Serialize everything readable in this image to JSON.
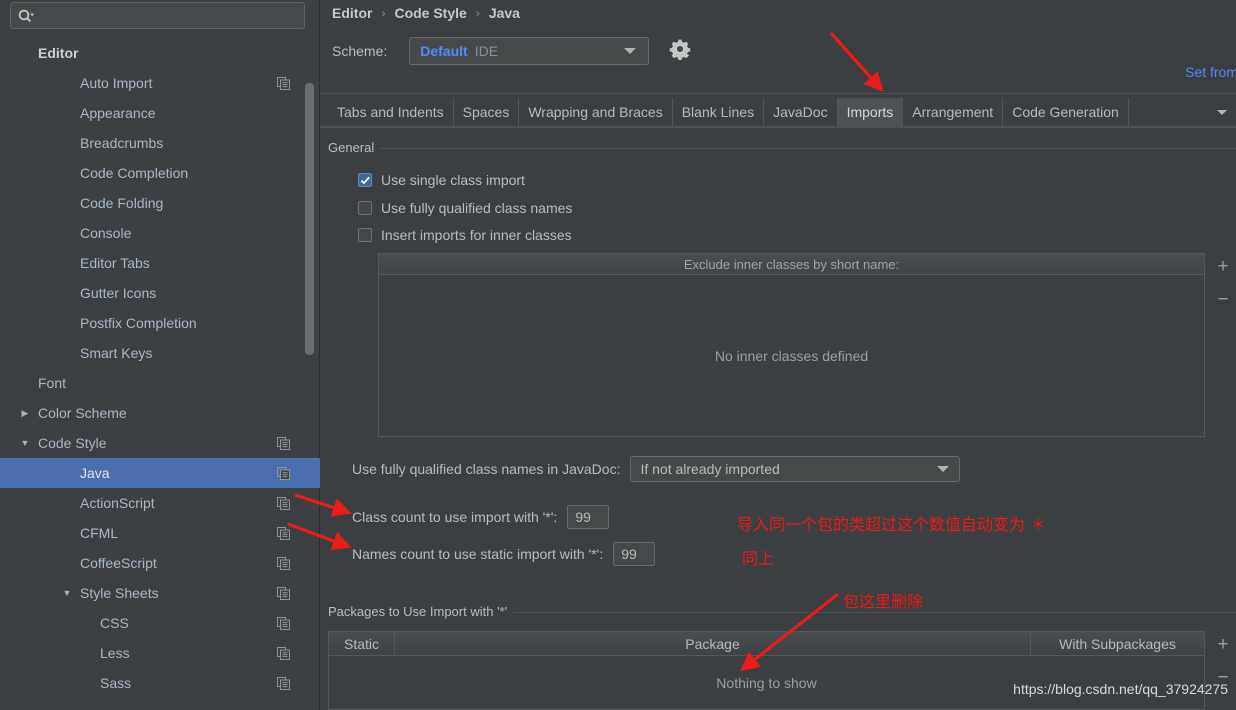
{
  "sidebar": {
    "search": {
      "value": "",
      "placeholder": "",
      "icon": "search-icon"
    },
    "items": [
      {
        "label": "Editor",
        "level": 0,
        "bold": true,
        "arrow": "",
        "copy": false,
        "selected": false
      },
      {
        "label": "Auto Import",
        "level": 1,
        "bold": false,
        "arrow": "",
        "copy": true,
        "selected": false
      },
      {
        "label": "Appearance",
        "level": 1,
        "bold": false,
        "arrow": "",
        "copy": false,
        "selected": false
      },
      {
        "label": "Breadcrumbs",
        "level": 1,
        "bold": false,
        "arrow": "",
        "copy": false,
        "selected": false
      },
      {
        "label": "Code Completion",
        "level": 1,
        "bold": false,
        "arrow": "",
        "copy": false,
        "selected": false
      },
      {
        "label": "Code Folding",
        "level": 1,
        "bold": false,
        "arrow": "",
        "copy": false,
        "selected": false
      },
      {
        "label": "Console",
        "level": 1,
        "bold": false,
        "arrow": "",
        "copy": false,
        "selected": false
      },
      {
        "label": "Editor Tabs",
        "level": 1,
        "bold": false,
        "arrow": "",
        "copy": false,
        "selected": false
      },
      {
        "label": "Gutter Icons",
        "level": 1,
        "bold": false,
        "arrow": "",
        "copy": false,
        "selected": false
      },
      {
        "label": "Postfix Completion",
        "level": 1,
        "bold": false,
        "arrow": "",
        "copy": false,
        "selected": false
      },
      {
        "label": "Smart Keys",
        "level": 1,
        "bold": false,
        "arrow": "",
        "copy": false,
        "selected": false
      },
      {
        "label": "Font",
        "level": 0,
        "bold": false,
        "arrow": "",
        "copy": false,
        "selected": false
      },
      {
        "label": "Color Scheme",
        "level": 0,
        "bold": false,
        "arrow": "▶",
        "copy": false,
        "selected": false
      },
      {
        "label": "Code Style",
        "level": 0,
        "bold": false,
        "arrow": "▼",
        "copy": true,
        "selected": false
      },
      {
        "label": "Java",
        "level": 1,
        "bold": false,
        "arrow": "",
        "copy": true,
        "selected": true
      },
      {
        "label": "ActionScript",
        "level": 1,
        "bold": false,
        "arrow": "",
        "copy": true,
        "selected": false
      },
      {
        "label": "CFML",
        "level": 1,
        "bold": false,
        "arrow": "",
        "copy": true,
        "selected": false
      },
      {
        "label": "CoffeeScript",
        "level": 1,
        "bold": false,
        "arrow": "",
        "copy": true,
        "selected": false
      },
      {
        "label": "Style Sheets",
        "level": 1,
        "bold": false,
        "arrow": "▼",
        "copy": true,
        "selected": false
      },
      {
        "label": "CSS",
        "level": 2,
        "bold": false,
        "arrow": "",
        "copy": true,
        "selected": false
      },
      {
        "label": "Less",
        "level": 2,
        "bold": false,
        "arrow": "",
        "copy": true,
        "selected": false
      },
      {
        "label": "Sass",
        "level": 2,
        "bold": false,
        "arrow": "",
        "copy": true,
        "selected": false
      }
    ]
  },
  "breadcrumb": {
    "items": [
      "Editor",
      "Code Style",
      "Java"
    ],
    "separator": "›"
  },
  "scheme": {
    "label": "Scheme:",
    "name": "Default",
    "qualifier": "IDE",
    "gear_icon": "gear-icon",
    "set_from_label": "Set from"
  },
  "tabs": {
    "items": [
      {
        "label": "Tabs and Indents",
        "active": false
      },
      {
        "label": "Spaces",
        "active": false
      },
      {
        "label": "Wrapping and Braces",
        "active": false
      },
      {
        "label": "Blank Lines",
        "active": false
      },
      {
        "label": "JavaDoc",
        "active": false
      },
      {
        "label": "Imports",
        "active": true
      },
      {
        "label": "Arrangement",
        "active": false
      },
      {
        "label": "Code Generation",
        "active": false
      }
    ]
  },
  "general": {
    "title": "General",
    "checkboxes": [
      {
        "label": "Use single class import",
        "checked": true
      },
      {
        "label": "Use fully qualified class names",
        "checked": false
      },
      {
        "label": "Insert imports for inner classes",
        "checked": false
      }
    ]
  },
  "exclude_table": {
    "header": "Exclude inner classes by short name:",
    "empty_text": "No inner classes defined",
    "add_label": "+",
    "remove_label": "−"
  },
  "javadoc": {
    "label": "Use fully qualified class names in JavaDoc:",
    "value": "If not already imported"
  },
  "counts": [
    {
      "label": "Class count to use import with '*':",
      "value": "99"
    },
    {
      "label": "Names count to use static import with '*':",
      "value": "99"
    }
  ],
  "packages": {
    "title": "Packages to Use Import with '*'",
    "columns": [
      "Static",
      "Package",
      "With Subpackages"
    ],
    "empty_text": "Nothing to show",
    "add_label": "+",
    "remove_label": "−"
  },
  "annotations": {
    "color": "#ea1c1c",
    "notes": [
      {
        "text": "导入同一个包的类超过这个数值自动变为 ＊"
      },
      {
        "text": "同上"
      },
      {
        "text": "包这里删除"
      }
    ]
  },
  "watermark": "https://blog.csdn.net/qq_37924275"
}
